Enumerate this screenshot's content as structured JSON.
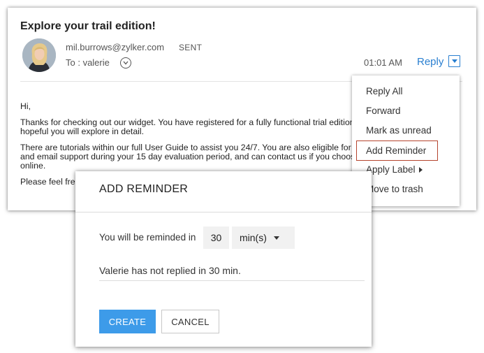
{
  "email": {
    "subject": "Explore your trail edition!",
    "sender": "mil.burrows@zylker.com",
    "status": "SENT",
    "to": "To : valerie",
    "time": "01:01 AM",
    "reply_label": "Reply",
    "body": {
      "greeting": "Hi,",
      "para1_line1": "Thanks for checking out our widget.  You have registered for a fully functional trial edition.",
      "para1_line2": "hopeful you will explore in detail.",
      "para2_line1": "There are tutorials within our full User Guide to assist you 24/7.  You are also eligible for phone",
      "para2_line2": "and email support during your 15 day evaluation period, and can contact us if you choose to go",
      "para2_line3": "online.",
      "para3_line1": "Please feel free"
    }
  },
  "menu": {
    "items": [
      {
        "label": "Reply All"
      },
      {
        "label": "Forward"
      },
      {
        "label": "Mark as unread"
      },
      {
        "label": "Add Reminder"
      },
      {
        "label": "Apply Label"
      },
      {
        "label": "Move to trash"
      }
    ]
  },
  "dialog": {
    "title": "ADD REMINDER",
    "remind_label": "You will be reminded in",
    "quantity": "30",
    "unit": "min(s)",
    "status_message": "Valerie has not replied in 30 min.",
    "create_label": "CREATE",
    "cancel_label": "CANCEL"
  },
  "colors": {
    "accent": "#3d9be9",
    "link": "#2a7fd0",
    "highlight_border": "#b5442e"
  },
  "icons": {
    "expand": "chevron-circle-down-icon",
    "dropdown": "caret-down-icon",
    "submenu": "caret-right-icon"
  }
}
